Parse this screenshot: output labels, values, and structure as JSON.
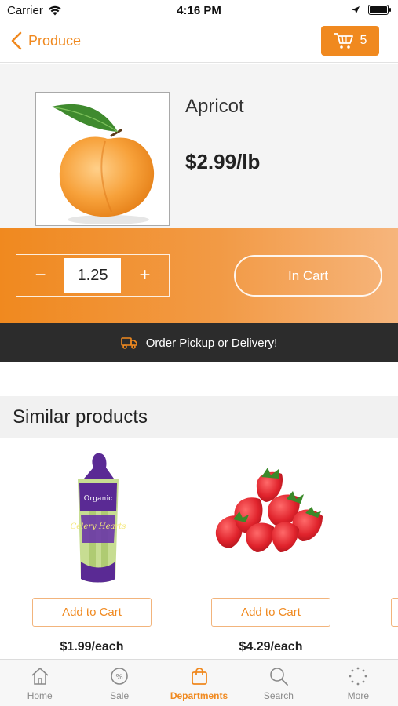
{
  "status_bar": {
    "carrier": "Carrier",
    "time": "4:16 PM"
  },
  "nav": {
    "back_label": "Produce",
    "cart_count": "5"
  },
  "product": {
    "name": "Apricot",
    "price": "$2.99/lb"
  },
  "quantity": {
    "value": "1.25",
    "minus": "−",
    "plus": "+"
  },
  "cart_button": {
    "label": "In Cart"
  },
  "order_banner": {
    "text": "Order Pickup or Delivery!"
  },
  "similar": {
    "title": "Similar products",
    "items": [
      {
        "image_label": "Celery Hearts",
        "button": "Add to Cart",
        "price": "$1.99/each"
      },
      {
        "image_label": "Strawberries",
        "button": "Add to Cart",
        "price": "$4.29/each"
      }
    ]
  },
  "tabs": [
    {
      "label": "Home",
      "icon": "home-icon"
    },
    {
      "label": "Sale",
      "icon": "percent-icon"
    },
    {
      "label": "Departments",
      "icon": "shopping-bag-icon"
    },
    {
      "label": "Search",
      "icon": "search-icon"
    },
    {
      "label": "More",
      "icon": "more-icon"
    }
  ],
  "active_tab": "Departments",
  "colors": {
    "accent": "#f0891f",
    "banner": "#2c2c2c",
    "tab_inactive": "#8a8a8a"
  }
}
